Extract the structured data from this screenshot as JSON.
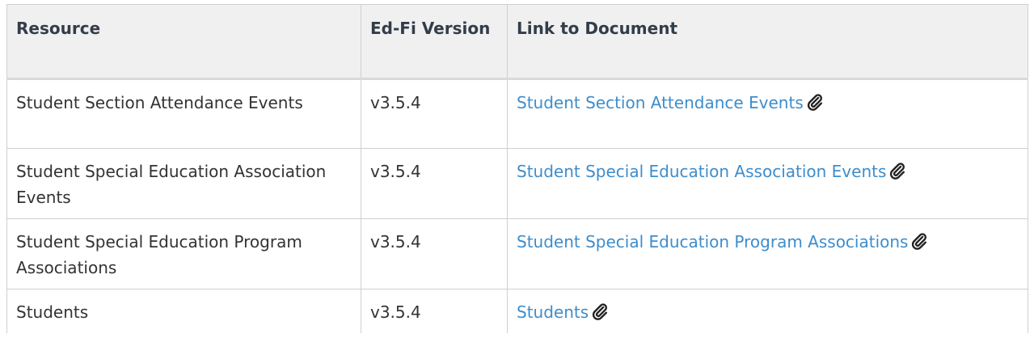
{
  "table": {
    "headers": {
      "resource": "Resource",
      "version": "Ed-Fi Version",
      "link": "Link to Document"
    },
    "rows": [
      {
        "resource": "Student Section Attendance Events",
        "version": "v3.5.4",
        "link_text": "Student Section Attendance Events",
        "link_icon": "paperclip-icon"
      },
      {
        "resource": "Student Special Education Association Events",
        "version": "v3.5.4",
        "link_text": "Student Special Education Association Events",
        "link_icon": "paperclip-icon"
      },
      {
        "resource": "Student Special Education Program Associations",
        "version": "v3.5.4",
        "link_text": "Student Special Education Program Associations",
        "link_icon": "paperclip-icon"
      },
      {
        "resource": "Students",
        "version": "v3.5.4",
        "link_text": "Students",
        "link_icon": "paperclip-icon"
      }
    ]
  },
  "colors": {
    "link": "#3e8dcb",
    "header_bg": "#f0f0f0",
    "header_text": "#333d4a",
    "body_text": "#333333",
    "border": "#cfcfcf"
  }
}
